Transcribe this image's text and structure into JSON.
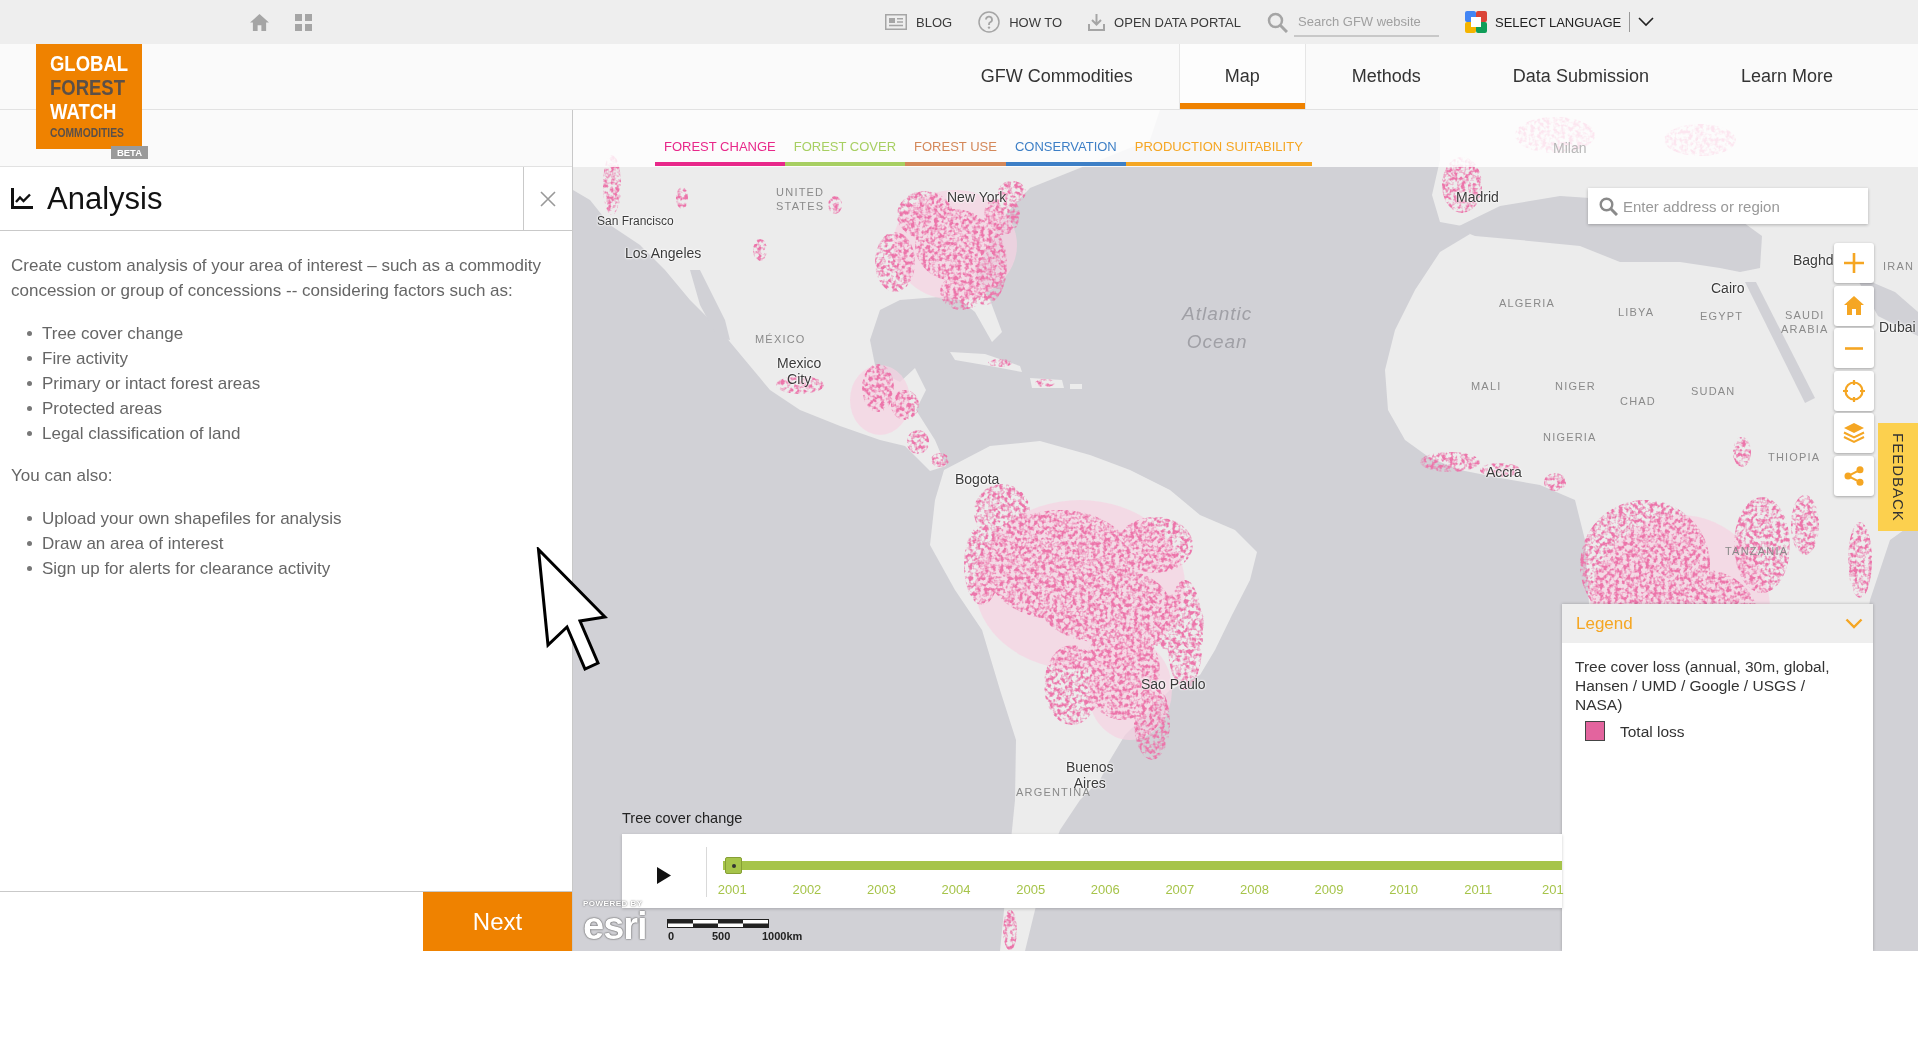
{
  "top_bar": {
    "links": [
      {
        "kind": "blog",
        "label": "BLOG"
      },
      {
        "kind": "help",
        "label": "HOW TO"
      },
      {
        "kind": "download",
        "label": "OPEN DATA PORTAL"
      }
    ],
    "search": {
      "placeholder": "Search GFW website"
    },
    "language_button": "SELECT LANGUAGE"
  },
  "header": {
    "logo": {
      "lines": [
        "GLOBAL",
        "FOREST",
        "WATCH",
        "COMMODITIES"
      ],
      "badge": "BETA"
    },
    "nav": [
      {
        "label": "GFW Commodities",
        "selected": false
      },
      {
        "label": "Map",
        "selected": true
      },
      {
        "label": "Methods",
        "selected": false
      },
      {
        "label": "Data Submission",
        "selected": false
      },
      {
        "label": "Learn More",
        "selected": false
      }
    ]
  },
  "analysis_panel": {
    "title": "Analysis",
    "intro": "Create custom analysis of your area of interest – such as a commodity concession or group of concessions -- considering factors such as:",
    "factors": [
      "Tree cover change",
      "Fire activity",
      "Primary or intact forest areas",
      "Protected areas",
      "Legal classification of land"
    ],
    "also": "You can also:",
    "options": [
      "Upload your own shapefiles for analysis",
      "Draw an area of interest",
      "Sign up for alerts for clearance activity"
    ],
    "next_button": "Next"
  },
  "map": {
    "category_tabs": [
      {
        "label": "FOREST CHANGE",
        "color": "#e8288a"
      },
      {
        "label": "FOREST COVER",
        "color": "#a7cf62"
      },
      {
        "label": "FOREST USE",
        "color": "#d4885a"
      },
      {
        "label": "CONSERVATION",
        "color": "#3d7fc6"
      },
      {
        "label": "PRODUCTION SUITABILITY",
        "color": "#f5a623"
      }
    ],
    "labels": [
      {
        "text": "Milan",
        "kind": "city"
      },
      {
        "text": "UNITED STATES",
        "kind": "country"
      },
      {
        "text": "New York",
        "kind": "city"
      },
      {
        "text": "Madrid",
        "kind": "city"
      },
      {
        "text": "San Francisco",
        "kind": "city"
      },
      {
        "text": "Los Angeles",
        "kind": "city"
      },
      {
        "text": "Baghd",
        "kind": "city"
      },
      {
        "text": "IRAN",
        "kind": "country"
      },
      {
        "text": "Cairo",
        "kind": "city"
      },
      {
        "text": "Atlantic Ocean",
        "kind": "ocean"
      },
      {
        "text": "ALGERIA",
        "kind": "country"
      },
      {
        "text": "LIBYA",
        "kind": "country"
      },
      {
        "text": "EGYPT",
        "kind": "country"
      },
      {
        "text": "SAUDI ARABIA",
        "kind": "country"
      },
      {
        "text": "Dubai",
        "kind": "city"
      },
      {
        "text": "MÉXICO",
        "kind": "country"
      },
      {
        "text": "Mexico City",
        "kind": "city"
      },
      {
        "text": "MALI",
        "kind": "country"
      },
      {
        "text": "NIGER",
        "kind": "country"
      },
      {
        "text": "CHAD",
        "kind": "country"
      },
      {
        "text": "SUDAN",
        "kind": "country"
      },
      {
        "text": "NIGERIA",
        "kind": "country"
      },
      {
        "text": "THIOPIA",
        "kind": "country"
      },
      {
        "text": "Bogota",
        "kind": "city"
      },
      {
        "text": "Accra",
        "kind": "city"
      },
      {
        "text": "TANZANIA",
        "kind": "country"
      },
      {
        "text": "Sao Paulo",
        "kind": "city"
      },
      {
        "text": "Buenos Aires",
        "kind": "city"
      },
      {
        "text": "ARGENTINA",
        "kind": "country"
      }
    ],
    "search": {
      "placeholder": "Enter address or region"
    },
    "feedback_tab": "FEEDBACK",
    "legend": {
      "title": "Legend",
      "layer": "Tree cover loss (annual, 30m, global, Hansen / UMD / Google / USGS / NASA)",
      "items": [
        {
          "label": "Total loss",
          "color": "#e3649e"
        }
      ]
    },
    "timeline": {
      "title": "Tree cover change",
      "level": 1,
      "years": [
        "2001",
        "2002",
        "2003",
        "2004",
        "2005",
        "2006",
        "2007",
        "2008",
        "2009",
        "2010",
        "2011",
        "201"
      ]
    },
    "attribution": {
      "powered_by": "POWERED BY",
      "logo": "esri"
    },
    "scale_labels": [
      "0",
      "500",
      "1000km"
    ]
  }
}
